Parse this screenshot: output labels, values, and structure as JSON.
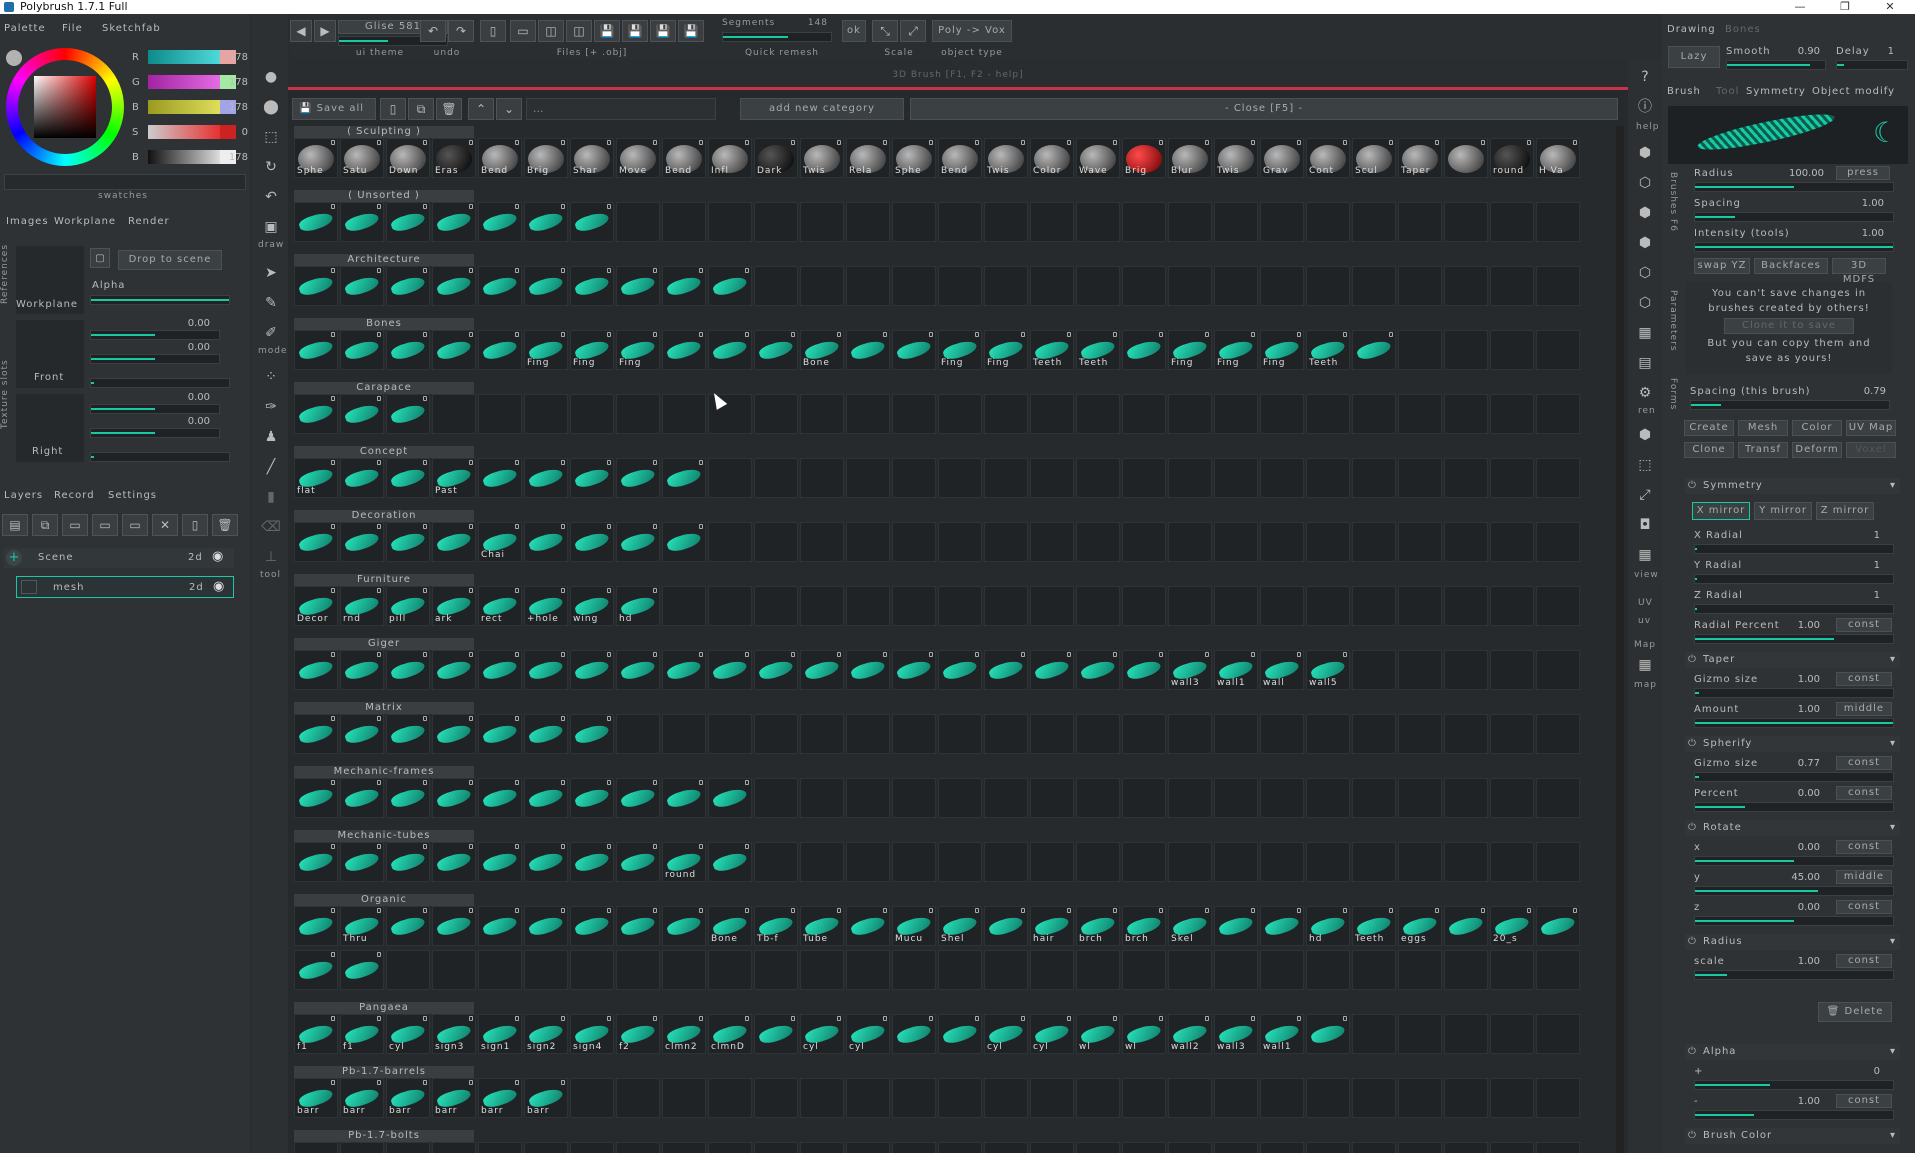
{
  "window": {
    "title": "Polybrush 1.7.1 Full",
    "minimize": "—",
    "maximize": "❐",
    "close": "✕"
  },
  "left": {
    "tabs": [
      "Palette",
      "File",
      "Sketchfab"
    ],
    "rgb": [
      {
        "label": "R",
        "value": "178"
      },
      {
        "label": "G",
        "value": "178"
      },
      {
        "label": "B",
        "value": "178"
      },
      {
        "label": "S",
        "value": "0"
      },
      {
        "label": "B",
        "value": "178"
      }
    ],
    "swatches_label": "swatches",
    "img_tabs": [
      "Images",
      "Workplane",
      "Render"
    ],
    "refs_label": "References",
    "slots_label": "Texture slots",
    "drop_btn": "Drop to scene",
    "alpha_label": "Alpha",
    "workplane": "Workplane",
    "front": "Front",
    "right": "Right",
    "values": [
      "0.00",
      "0.00",
      "0.00",
      "0.00"
    ],
    "layer_tabs": [
      "Layers",
      "Record",
      "Settings"
    ],
    "scene": "Scene",
    "mesh": "mesh",
    "twod": "2d"
  },
  "toolstrip": {
    "draw": "draw",
    "mode": "mode",
    "tool": "tool"
  },
  "topbar": {
    "theme_name": "Glise 581",
    "ui_theme": "ui theme",
    "undo": "undo",
    "files": "Files [+ .obj]",
    "segments_label": "Segments",
    "segments_value": "148",
    "quick_remesh": "Quick remesh",
    "ok": "ok",
    "scale": "Scale",
    "poly_vox": "Poly -> Vox",
    "object_type": "object type"
  },
  "main": {
    "header": "3D Brush  [F1, F2 - help]",
    "save_all": "Save all",
    "search": "...",
    "add_category": "add new category",
    "close": "- Close [F5] -",
    "categories": [
      {
        "title": "( Sculpting )",
        "type": "mix",
        "cells": [
          "Sphe",
          "Satu",
          "Down",
          "Eras",
          "Bend",
          "Brig",
          "Shar",
          "Move",
          "Bend",
          "Infl",
          "Dark",
          "Twis",
          "Rela",
          "Sphe",
          "Bend",
          "Twis",
          "Color",
          "Wave",
          "Brig",
          "Blur",
          "Twis",
          "Grav",
          "Cont",
          "Scul",
          "Taper",
          "",
          "round",
          "H Va"
        ]
      },
      {
        "title": "( Unsorted )",
        "type": "b",
        "count": 7,
        "cells": []
      },
      {
        "title": "Architecture",
        "type": "b",
        "count": 10,
        "cells": []
      },
      {
        "title": "Bones",
        "type": "b",
        "count": 24,
        "cells": [
          "",
          "",
          "",
          "",
          "",
          "Fing",
          "Fing",
          "Fing",
          "",
          "",
          "",
          "Bone",
          "",
          "",
          "Fing",
          "Fing",
          "Teeth",
          "Teeth",
          "",
          "Fing",
          "Fing",
          "Fing",
          "Teeth",
          ""
        ]
      },
      {
        "title": "Carapace",
        "type": "b",
        "count": 3,
        "cells": []
      },
      {
        "title": "Concept",
        "type": "b",
        "count": 9,
        "cells": [
          "flat",
          "",
          "",
          "Past",
          "",
          "",
          "",
          "",
          ""
        ]
      },
      {
        "title": "Decoration",
        "type": "b",
        "count": 9,
        "cells": [
          "",
          "",
          "",
          "",
          "Chai",
          "",
          "",
          "",
          ""
        ]
      },
      {
        "title": "Furniture",
        "type": "b",
        "count": 8,
        "cells": [
          "Decor",
          "rnd",
          "pill",
          "ark",
          "rect",
          "+hole",
          "wing",
          "hd"
        ]
      },
      {
        "title": "Giger",
        "type": "b",
        "count": 23,
        "cells": [
          "",
          "",
          "",
          "",
          "",
          "",
          "",
          "",
          "",
          "",
          "",
          "",
          "",
          "",
          "",
          "",
          "",
          "",
          "",
          "wall3",
          "wall1",
          "wall",
          "wall5"
        ]
      },
      {
        "title": "Matrix",
        "type": "b",
        "count": 7,
        "cells": []
      },
      {
        "title": "Mechanic-frames",
        "type": "b",
        "count": 10,
        "cells": []
      },
      {
        "title": "Mechanic-tubes",
        "type": "b",
        "count": 10,
        "cells": [
          "",
          "",
          "",
          "",
          "",
          "",
          "",
          "",
          "round",
          ""
        ]
      },
      {
        "title": "Organic",
        "type": "b",
        "count": 30,
        "cells": [
          "",
          "Thru",
          "",
          "",
          "",
          "",
          "",
          "",
          "",
          "Bone",
          "Tb-f",
          "Tube",
          "",
          "Mucu",
          "Shel",
          "",
          "hair",
          "brch",
          "brch",
          "Skel",
          "",
          "",
          "hd",
          "Teeth",
          "eggs",
          "",
          "20_s",
          "",
          "",
          ""
        ]
      },
      {
        "title": "Pangaea",
        "type": "b",
        "count": 23,
        "cells": [
          "f1",
          "f1",
          "cyl",
          "sign3",
          "sign1",
          "sign2",
          "sign4",
          "f2",
          "clmn2",
          "clmnD",
          "",
          "cyl",
          "cyl",
          "",
          "",
          "cyl",
          "cyl",
          "wl",
          "wl",
          "wall2",
          "wall3",
          "wall1",
          ""
        ]
      },
      {
        "title": "Pb-1.7-barrels",
        "type": "b",
        "count": 6,
        "cells": [
          "barr",
          "barr",
          "barr",
          "barr",
          "barr",
          "barr"
        ]
      },
      {
        "title": "Pb-1.7-bolts",
        "type": "b",
        "count": 0,
        "cells": []
      }
    ]
  },
  "right": {
    "tabs": [
      "Drawing",
      "Bones"
    ],
    "lazy": "Lazy",
    "smooth_label": "Smooth",
    "smooth_value": "0.90",
    "delay_label": "Delay",
    "delay_value": "1",
    "brush_tabs": [
      "Brush",
      "Tool",
      "Symmetry",
      "Object modify"
    ],
    "brushes_side": "Brushes F6",
    "radius_label": "Radius",
    "radius_value": "100.00",
    "press": "press",
    "spacing_label": "Spacing",
    "spacing_value": "1.00",
    "intensity_label": "Intensity (tools)",
    "intensity_value": "1.00",
    "swap": "swap YZ",
    "backfaces": "Backfaces",
    "mdfs": "3D MDFS",
    "params_side": "Parameters",
    "forms_side": "Forms",
    "warn1": "You can't save changes in brushes created by others!",
    "clone_to_save": "Clone it to save",
    "warn2": "But you can copy them and save as yours!",
    "spacing_this_label": "Spacing (this brush)",
    "spacing_this_value": "0.79",
    "actions": [
      "Create",
      "Mesh",
      "Color",
      "UV Map",
      "Clone",
      "Transf",
      "Deform",
      "Voxel"
    ],
    "symmetry": "Symmetry",
    "mirrors": [
      "X mirror",
      "Y mirror",
      "Z mirror"
    ],
    "xr": "X Radial",
    "yr": "Y Radial",
    "zr": "Z Radial",
    "radial_value": "1",
    "radial_percent": "Radial Percent",
    "radial_percent_value": "1.00",
    "const": "const",
    "middle": "middle",
    "taper": "Taper",
    "gizmo_size": "Gizmo size",
    "gizmo_value": "1.00",
    "amount": "Amount",
    "amount_value": "1.00",
    "spherify": "Spherify",
    "sph_gizmo_value": "0.77",
    "percent": "Percent",
    "percent_value": "0.00",
    "rotate": "Rotate",
    "rx": "x",
    "rx_value": "0.00",
    "ry": "y",
    "ry_value": "45.00",
    "rz": "z",
    "rz_value": "0.00",
    "radius_sec": "Radius",
    "scale": "scale",
    "scale_value": "1.00",
    "delete": "Delete",
    "alpha": "Alpha",
    "aplus": "+",
    "aplus_value": "0",
    "aminus": "-",
    "aminus_value": "1.00",
    "brush_color": "Brush Color"
  },
  "righttool": {
    "help": "help",
    "ren": "ren",
    "view": "view",
    "uv": "uv",
    "map": "map",
    "UV": "UV",
    "Map": "Map"
  }
}
